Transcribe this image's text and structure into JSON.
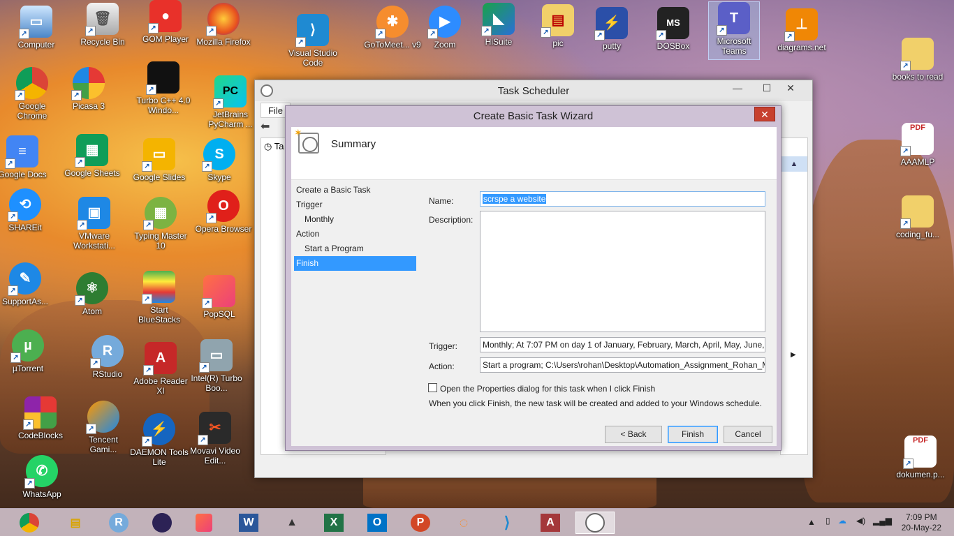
{
  "desktop": {
    "icons": [
      {
        "label": "Computer"
      },
      {
        "label": "Recycle Bin"
      },
      {
        "label": "GOM Player"
      },
      {
        "label": "Mozilla Firefox"
      },
      {
        "label": "Visual Studio Code"
      },
      {
        "label": "GoToMeet... v9"
      },
      {
        "label": "Zoom"
      },
      {
        "label": "HiSuite"
      },
      {
        "label": "pic"
      },
      {
        "label": "putty"
      },
      {
        "label": "DOSBox"
      },
      {
        "label": "Microsoft Teams"
      },
      {
        "label": "diagrams.net"
      },
      {
        "label": "books to read"
      },
      {
        "label": "Google Chrome"
      },
      {
        "label": "Picasa 3"
      },
      {
        "label": "Turbo C++ 4.0 Windo..."
      },
      {
        "label": "JetBrains PyCharm ..."
      },
      {
        "label": "Google Docs"
      },
      {
        "label": "Google Sheets"
      },
      {
        "label": "Google Slides"
      },
      {
        "label": "Skype"
      },
      {
        "label": "SHAREit"
      },
      {
        "label": "VMware Workstati..."
      },
      {
        "label": "Typing Master 10"
      },
      {
        "label": "Opera Browser"
      },
      {
        "label": "SupportAs..."
      },
      {
        "label": "Atom"
      },
      {
        "label": "Start BlueStacks"
      },
      {
        "label": "PopSQL"
      },
      {
        "label": "µTorrent"
      },
      {
        "label": "RStudio"
      },
      {
        "label": "Adobe Reader XI"
      },
      {
        "label": "Intel(R) Turbo Boo..."
      },
      {
        "label": "CodeBlocks"
      },
      {
        "label": "Tencent Gami..."
      },
      {
        "label": "DAEMON Tools Lite"
      },
      {
        "label": "Movavi Video Edit..."
      },
      {
        "label": "WhatsApp"
      },
      {
        "label": "AAAMLP"
      },
      {
        "label": "coding_fu..."
      },
      {
        "label": "dokumen.p..."
      }
    ],
    "pdf_badge": "PDF"
  },
  "task_scheduler": {
    "title": "Task Scheduler",
    "menu_file": "File",
    "tree_root": "Ta",
    "minimize": "—",
    "maximize": "☐",
    "close": "✕"
  },
  "wizard": {
    "title": "Create Basic Task Wizard",
    "close": "✕",
    "header_title": "Summary",
    "steps": [
      {
        "label": "Create a Basic Task"
      },
      {
        "label": "Trigger"
      },
      {
        "label": "Monthly"
      },
      {
        "label": "Action"
      },
      {
        "label": "Start a Program"
      },
      {
        "label": "Finish"
      }
    ],
    "name_label": "Name:",
    "name_value": "scrspe a website",
    "description_label": "Description:",
    "description_value": "",
    "trigger_label": "Trigger:",
    "trigger_value": "Monthly; At 7:07 PM  on day 1 of January, February, March, April, May, June,",
    "action_label": "Action:",
    "action_value": "Start a program; C:\\Users\\rohan\\Desktop\\Automation_Assignment_Rohan_M",
    "open_properties_label": "Open the Properties dialog for this task when I click Finish",
    "open_properties_checked": false,
    "info_text": "When you click Finish, the new task will be created and added to your Windows schedule.",
    "back_button": "< Back",
    "finish_button": "Finish",
    "cancel_button": "Cancel"
  },
  "taskbar": {
    "time": "7:09 PM",
    "date": "20-May-22"
  }
}
